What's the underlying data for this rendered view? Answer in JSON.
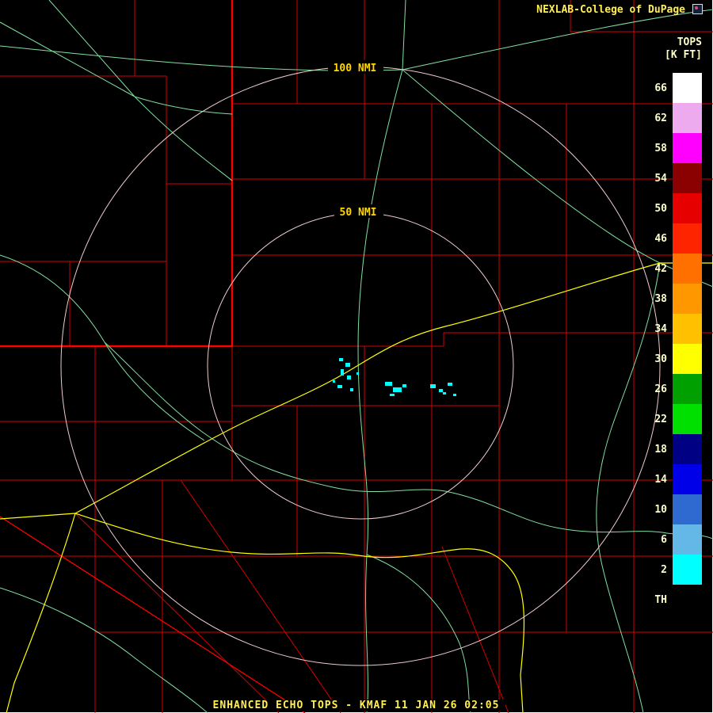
{
  "header": {
    "title": "NEXLAB-College of DuPage"
  },
  "legend": {
    "title": "TOPS",
    "unit": "[K FT]",
    "items": [
      {
        "label": "66",
        "color": "#ffffff"
      },
      {
        "label": "62",
        "color": "#eeaaee"
      },
      {
        "label": "58",
        "color": "#ff00ff"
      },
      {
        "label": "54",
        "color": "#8b0000"
      },
      {
        "label": "50",
        "color": "#e60000"
      },
      {
        "label": "46",
        "color": "#ff2400"
      },
      {
        "label": "42",
        "color": "#ff7000"
      },
      {
        "label": "38",
        "color": "#ff9800"
      },
      {
        "label": "34",
        "color": "#ffc000"
      },
      {
        "label": "30",
        "color": "#ffff00"
      },
      {
        "label": "26",
        "color": "#00a000"
      },
      {
        "label": "22",
        "color": "#00e000"
      },
      {
        "label": "18",
        "color": "#000085"
      },
      {
        "label": "14",
        "color": "#0000e8"
      },
      {
        "label": "10",
        "color": "#2e6ad0"
      },
      {
        "label": "6",
        "color": "#63b8e8"
      },
      {
        "label": "2",
        "color": "#00ffff"
      },
      {
        "label": "TH",
        "color": "#000000"
      }
    ]
  },
  "map": {
    "ring_labels": [
      "100 NMI",
      "50 NMI"
    ]
  },
  "footer": {
    "caption": "ENHANCED ECHO TOPS - KMAF 11 JAN 26 02:05"
  },
  "colors": {
    "county": "#d40000",
    "state_border": "#ff0000",
    "road": "#7fe0a0",
    "highway": "#ffff00",
    "ring": "#eecccc",
    "echo": "#00ffff",
    "label_text": "#ffd700",
    "header_text": "#ffee55",
    "scale_text": "#ffffcc",
    "background": "#000000"
  }
}
